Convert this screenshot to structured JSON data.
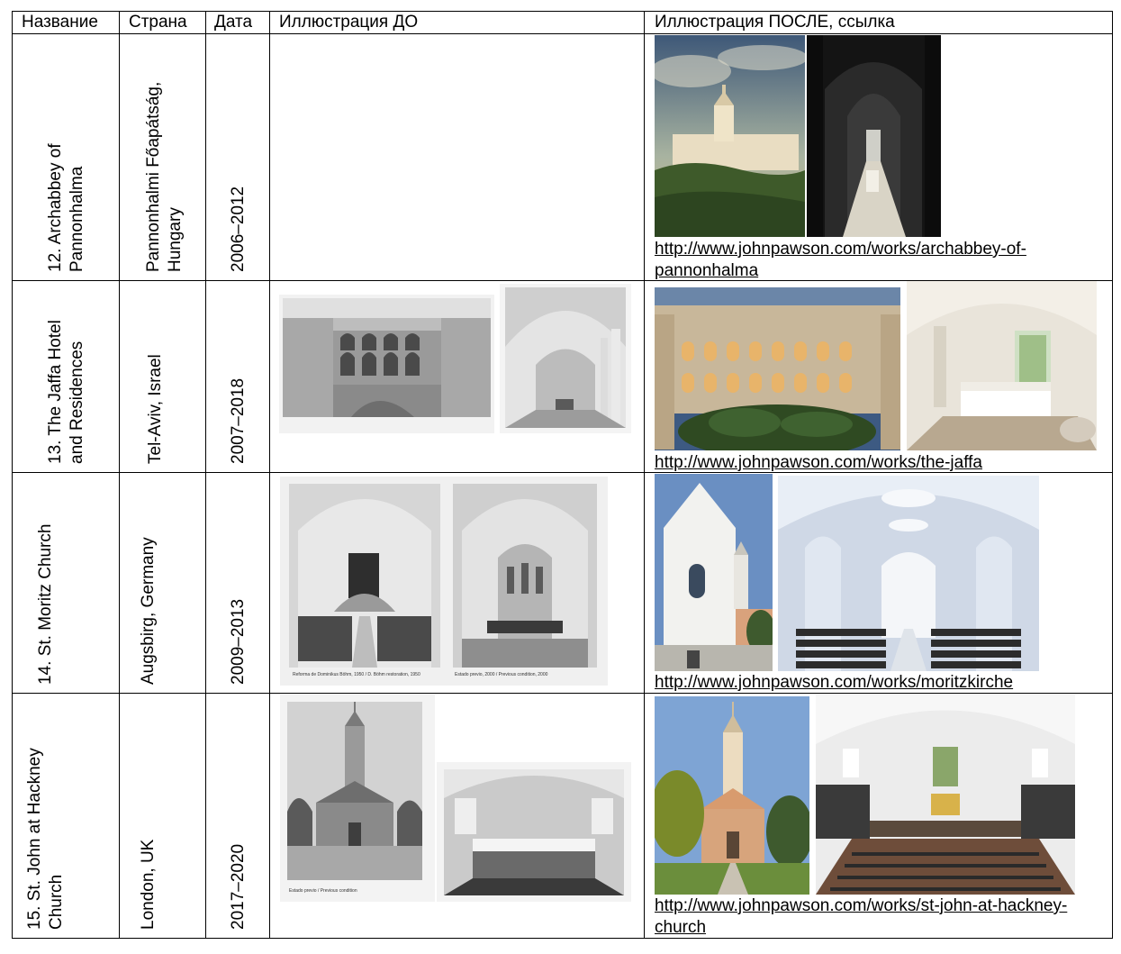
{
  "headers": {
    "name": "Название",
    "country": "Страна",
    "date": "Дата",
    "before": "Иллюстрация ДО",
    "after": "Иллюстрация ПОСЛЕ, ссылка"
  },
  "rows": [
    {
      "name": "12. Archabbey of\nPannonhalma",
      "country": "Pannonhalmi Főapátság,\nHungary",
      "date": "2006–2012",
      "link": "http://www.johnpawson.com/works/archabbey-of-\npannonhalma"
    },
    {
      "name": "13. The Jaffa Hotel\nand Residences",
      "country": "Tel-Aviv, Israel",
      "date": "2007–2018",
      "link": "http://www.johnpawson.com/works/the-jaffa"
    },
    {
      "name": "14. St. Moritz Church",
      "country": "Augsbirg, Germany",
      "date": "2009–2013",
      "link": "http://www.johnpawson.com/works/moritzkirche",
      "before_captions": [
        "Reforma de Dominikus Böhm, 1950 / D. Böhm restoration, 1950",
        "Estado previo, 2000 / Previous condition, 2000"
      ]
    },
    {
      "name": "15. St. John at Hackney\nChurch",
      "country": "London, UK",
      "date": "2017–2020",
      "link": "http://www.johnpawson.com/works/st-john-at-hackney-\nchurch",
      "before_captions": [
        "Estado previo / Previous condition"
      ]
    }
  ]
}
